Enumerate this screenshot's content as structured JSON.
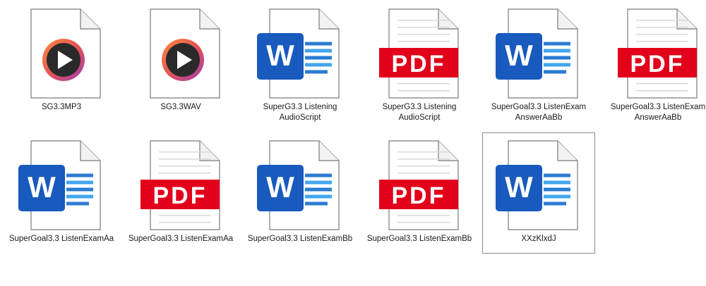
{
  "files": [
    {
      "name": "SG3.3MP3",
      "type": "media",
      "icon": "media-player-icon",
      "selected": false
    },
    {
      "name": "SG3.3WAV",
      "type": "media",
      "icon": "media-player-icon",
      "selected": false
    },
    {
      "name": "SuperG3.3 Listening\nAudioScript",
      "type": "word",
      "icon": "word-document-icon",
      "selected": false
    },
    {
      "name": "SuperG3.3 Listening\nAudioScript",
      "type": "pdf",
      "icon": "pdf-document-icon",
      "selected": false
    },
    {
      "name": "SuperGoal3.3 ListenExam\nAnswerAaBb",
      "type": "word",
      "icon": "word-document-icon",
      "selected": false
    },
    {
      "name": "SuperGoal3.3 ListenExam\nAnswerAaBb",
      "type": "pdf",
      "icon": "pdf-document-icon",
      "selected": false
    },
    {
      "name": "SuperGoal3.3 ListenExamAa",
      "type": "word",
      "icon": "word-document-icon",
      "selected": false
    },
    {
      "name": "SuperGoal3.3 ListenExamAa",
      "type": "pdf",
      "icon": "pdf-document-icon",
      "selected": false
    },
    {
      "name": "SuperGoal3.3 ListenExamBb",
      "type": "word",
      "icon": "word-document-icon",
      "selected": false
    },
    {
      "name": "SuperGoal3.3 ListenExamBb",
      "type": "pdf",
      "icon": "pdf-document-icon",
      "selected": false
    },
    {
      "name": "XXzKlxdJ",
      "type": "word",
      "icon": "word-document-icon",
      "selected": true
    }
  ],
  "icon_text": {
    "word": "W",
    "pdf": "PDF"
  },
  "colors": {
    "word_blue": "#185abd",
    "word_lines": "#2b7cd3",
    "pdf_red": "#e2001a",
    "page_border": "#7a7a7a",
    "selection_border": "#8a8a8a"
  }
}
